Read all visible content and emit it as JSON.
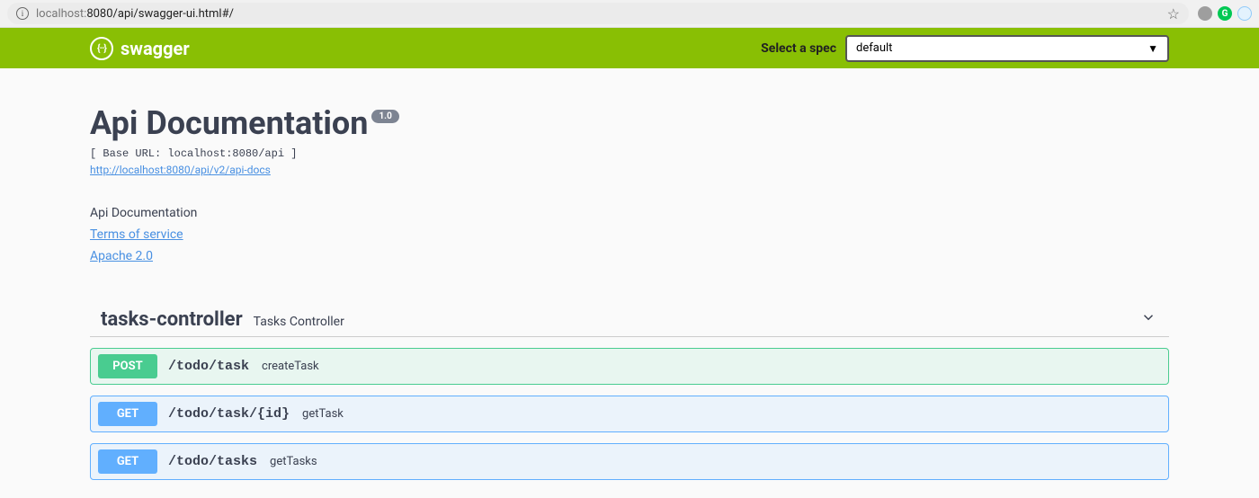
{
  "browser": {
    "url_host": "localhost:",
    "url_path": "8080/api/swagger-ui.html#/"
  },
  "topbar": {
    "brand": "swagger",
    "spec_label": "Select a spec",
    "spec_value": "default"
  },
  "info": {
    "title": "Api Documentation",
    "version": "1.0",
    "base_url_line": "[ Base URL: localhost:8080/api ]",
    "docs_url": "http://localhost:8080/api/v2/api-docs",
    "description": "Api Documentation",
    "terms_label": "Terms of service",
    "license_label": "Apache 2.0"
  },
  "tag": {
    "name": "tasks-controller",
    "description": "Tasks Controller"
  },
  "operations": [
    {
      "method": "POST",
      "path": "/todo/task",
      "summary": "createTask",
      "cls": "post"
    },
    {
      "method": "GET",
      "path": "/todo/task/{id}",
      "summary": "getTask",
      "cls": "get"
    },
    {
      "method": "GET",
      "path": "/todo/tasks",
      "summary": "getTasks",
      "cls": "get"
    }
  ]
}
